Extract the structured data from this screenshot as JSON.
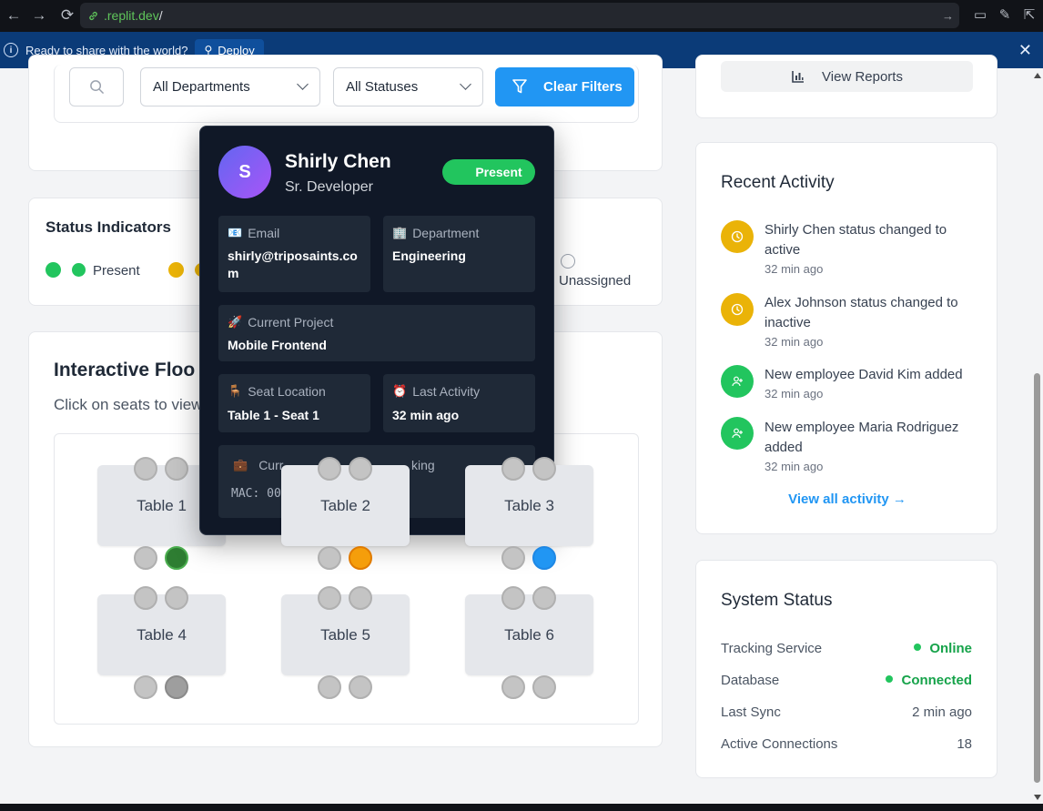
{
  "browser": {
    "url_domain": ".replit.dev",
    "url_path": "/"
  },
  "deploy_bar": {
    "message": "Ready to share with the world?",
    "deploy_label": "Deploy"
  },
  "filters": {
    "department_select": "All Departments",
    "status_select": "All Statuses",
    "clear_label": "Clear Filters"
  },
  "status_indicators": {
    "title": "Status Indicators",
    "present_label": "Present",
    "unassigned_label": "Unassigned",
    "colors": {
      "present": "#22c55e",
      "away": "#eab308",
      "unassigned": "#ffffff"
    }
  },
  "floor": {
    "title": "Interactive Floo",
    "subtitle": "Click on seats to view",
    "tables": [
      {
        "label": "Table 1",
        "seats": [
          "#c4c4c4",
          "#c4c4c4",
          "#c4c4c4",
          "#2e7d32"
        ]
      },
      {
        "label": "Table 2",
        "seats": [
          "#c4c4c4",
          "#c4c4c4",
          "#c4c4c4",
          "#f59e0b"
        ]
      },
      {
        "label": "Table 3",
        "seats": [
          "#c4c4c4",
          "#c4c4c4",
          "#c4c4c4",
          "#2196f3"
        ]
      },
      {
        "label": "Table 4",
        "seats": [
          "#c4c4c4",
          "#c4c4c4",
          "#c4c4c4",
          "#9e9e9e"
        ]
      },
      {
        "label": "Table 5",
        "seats": [
          "#c4c4c4",
          "#c4c4c4",
          "#c4c4c4",
          "#c4c4c4"
        ]
      },
      {
        "label": "Table 6",
        "seats": [
          "#c4c4c4",
          "#c4c4c4",
          "#c4c4c4",
          "#c4c4c4"
        ]
      }
    ]
  },
  "reports": {
    "label": "View Reports"
  },
  "activity": {
    "title": "Recent Activity",
    "items": [
      {
        "text": "Shirly Chen status changed to active",
        "time": "32 min ago",
        "icon": "clock-icon",
        "color": "#eab308"
      },
      {
        "text": "Alex Johnson status changed to inactive",
        "time": "32 min ago",
        "icon": "clock-icon",
        "color": "#eab308"
      },
      {
        "text": "New employee David Kim added",
        "time": "32 min ago",
        "icon": "user-plus-icon",
        "color": "#22c55e"
      },
      {
        "text": "New employee Maria Rodriguez added",
        "time": "32 min ago",
        "icon": "user-plus-icon",
        "color": "#22c55e"
      }
    ],
    "view_all": "View all activity →"
  },
  "system_status": {
    "title": "System Status",
    "rows": [
      {
        "label": "Tracking Service",
        "value": "Online"
      },
      {
        "label": "Database",
        "value": "Connected"
      },
      {
        "label": "Last Sync",
        "value": "2 min ago"
      },
      {
        "label": "Active Connections",
        "value": "18"
      }
    ]
  },
  "popup": {
    "initial": "S",
    "name": "Shirly Chen",
    "role": "Sr. Developer",
    "status": "Present",
    "email_label": "Email",
    "email_value": "shirly@triposaints.com",
    "department_label": "Department",
    "department_value": "Engineering",
    "project_label": "Current Project",
    "project_value": "Mobile Frontend",
    "seat_label": "Seat Location",
    "seat_value": "Table 1 - Seat 1",
    "activity_label": "Last Activity",
    "activity_value": "32 min ago",
    "device_label_start": "Curr",
    "device_label_end": "king",
    "mac_partial": "MAC: 00"
  }
}
